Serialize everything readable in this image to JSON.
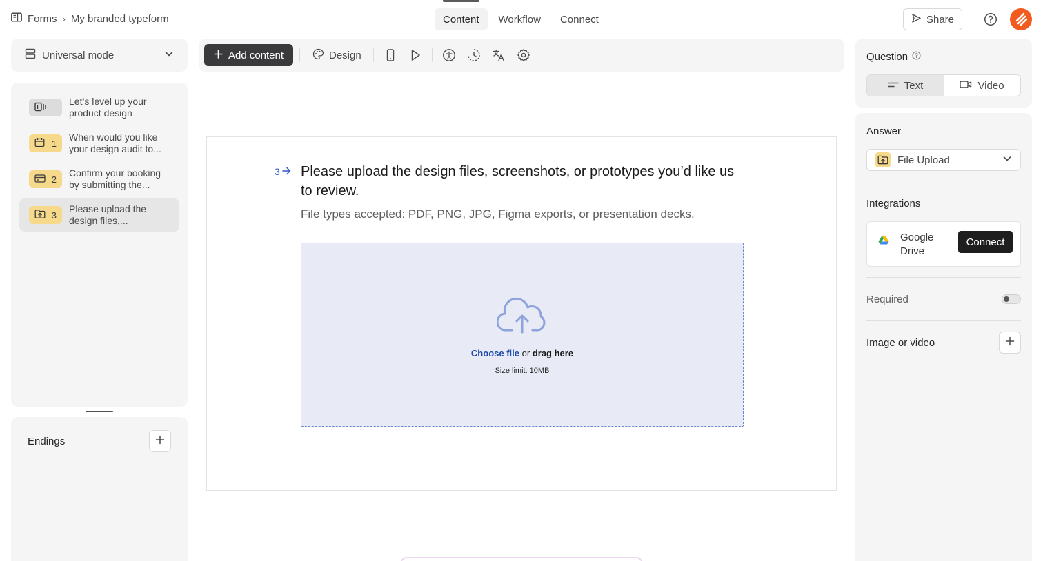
{
  "breadcrumb": {
    "root": "Forms",
    "separator": "›",
    "current": "My branded typeform"
  },
  "tabs": [
    {
      "label": "Content",
      "active": true
    },
    {
      "label": "Workflow",
      "active": false
    },
    {
      "label": "Connect",
      "active": false
    }
  ],
  "header": {
    "share_label": "Share",
    "accent_color": "#f25a1e"
  },
  "mode": {
    "label": "Universal mode"
  },
  "questions": [
    {
      "number": "",
      "icon": "welcome-screen-icon",
      "text": "Let’s level up your product design",
      "badge_color": "#dcdcdc",
      "selected": false
    },
    {
      "number": "1",
      "icon": "calendar-icon",
      "text": "When would you like your design audit to...",
      "badge_color": "#f7d98c",
      "selected": false
    },
    {
      "number": "2",
      "icon": "card-icon",
      "text": "Confirm your booking by submitting the...",
      "badge_color": "#f7d98c",
      "selected": false
    },
    {
      "number": "3",
      "icon": "folder-upload-icon",
      "text": "Please upload the design files,...",
      "badge_color": "#f7d98c",
      "selected": true
    }
  ],
  "endings": {
    "label": "Endings"
  },
  "toolbar": {
    "add_content_label": "Add content",
    "design_label": "Design"
  },
  "canvas": {
    "question_number": "3",
    "question_title": "Please upload the design files, screenshots, or prototypes you’d like us to review.",
    "question_description": "File types accepted: PDF, PNG, JPG, Figma exports, or presentation decks.",
    "upload": {
      "choose_label": "Choose file",
      "or_label": "or",
      "drag_label": "drag here",
      "size_limit": "Size limit: 10MB"
    }
  },
  "right_panel": {
    "question_label": "Question",
    "question_types": [
      {
        "label": "Text",
        "icon": "text-icon",
        "active": true
      },
      {
        "label": "Video",
        "icon": "video-icon",
        "active": false
      }
    ],
    "answer_label": "Answer",
    "answer_type": "File Upload",
    "integrations_label": "Integrations",
    "integration_name": "Google Drive",
    "connect_label": "Connect",
    "required_label": "Required",
    "required_on": false,
    "image_video_label": "Image or video"
  }
}
